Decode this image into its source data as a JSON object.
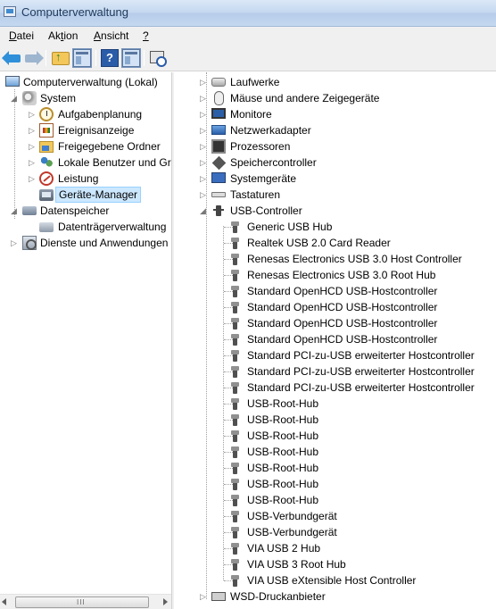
{
  "window": {
    "title": "Computerverwaltung"
  },
  "menu": [
    {
      "pre": "",
      "u": "D",
      "post": "atei"
    },
    {
      "pre": "Ak",
      "u": "t",
      "post": "ion"
    },
    {
      "pre": "",
      "u": "A",
      "post": "nsicht"
    },
    {
      "pre": "",
      "u": "?",
      "post": ""
    }
  ],
  "toolbar": {
    "back": "back-arrow-icon",
    "forward": "forward-arrow-icon",
    "help_glyph": "?"
  },
  "left_tree": {
    "root": "Computerverwaltung (Lokal)",
    "system": "System",
    "aufgabenplanung": "Aufgabenplanung",
    "ereignisanzeige": "Ereignisanzeige",
    "freigegebene_ordner": "Freigegebene Ordner",
    "lokale_benutzer": "Lokale Benutzer und Gr",
    "leistung": "Leistung",
    "geraete_manager": "Geräte-Manager",
    "datenspeicher": "Datenspeicher",
    "datentraegerverwaltung": "Datenträgerverwaltung",
    "dienste": "Dienste und Anwendungen"
  },
  "device_categories": [
    "Laufwerke",
    "Mäuse und andere Zeigegeräte",
    "Monitore",
    "Netzwerkadapter",
    "Prozessoren",
    "Speichercontroller",
    "Systemgeräte",
    "Tastaturen",
    "USB-Controller"
  ],
  "usb_devices": [
    "Generic USB Hub",
    "Realtek USB 2.0 Card Reader",
    "Renesas Electronics USB 3.0 Host Controller",
    "Renesas Electronics USB 3.0 Root Hub",
    "Standard OpenHCD USB-Hostcontroller",
    "Standard OpenHCD USB-Hostcontroller",
    "Standard OpenHCD USB-Hostcontroller",
    "Standard OpenHCD USB-Hostcontroller",
    "Standard PCI-zu-USB erweiterter Hostcontroller",
    "Standard PCI-zu-USB erweiterter Hostcontroller",
    "Standard PCI-zu-USB erweiterter Hostcontroller",
    "USB-Root-Hub",
    "USB-Root-Hub",
    "USB-Root-Hub",
    "USB-Root-Hub",
    "USB-Root-Hub",
    "USB-Root-Hub",
    "USB-Root-Hub",
    "USB-Verbundgerät",
    "USB-Verbundgerät",
    "VIA USB 2 Hub",
    "VIA USB 3 Root Hub",
    "VIA USB eXtensible Host Controller"
  ],
  "last_category": "WSD-Druckanbieter",
  "scrollbar": {
    "grip": "III"
  }
}
